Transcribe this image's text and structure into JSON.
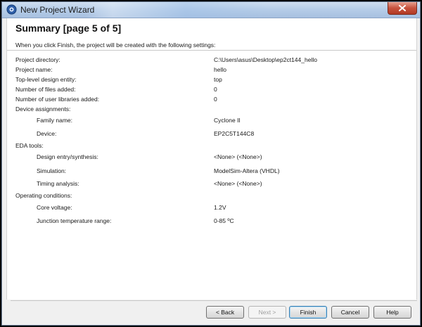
{
  "window": {
    "title": "New Project Wizard"
  },
  "page": {
    "title": "Summary [page 5 of 5]",
    "intro": "When you click Finish, the project will be created with the following settings:"
  },
  "rows": [
    {
      "label": "Project directory:",
      "value": "C:\\Users\\asus\\Desktop\\ep2ct144_hello"
    },
    {
      "label": "Project name:",
      "value": "hello"
    },
    {
      "label": "Top-level design entity:",
      "value": "top"
    },
    {
      "label": "Number of files added:",
      "value": "0"
    },
    {
      "label": "Number of user libraries added:",
      "value": "0"
    },
    {
      "label": "Device assignments:",
      "value": ""
    },
    {
      "label": "Family name:",
      "value": "Cyclone II"
    },
    {
      "label": "Device:",
      "value": "EP2C5T144C8"
    },
    {
      "label": "EDA tools:",
      "value": ""
    },
    {
      "label": "Design entry/synthesis:",
      "value": "<None> (<None>)"
    },
    {
      "label": "Simulation:",
      "value": "ModelSim-Altera (VHDL)"
    },
    {
      "label": "Timing analysis:",
      "value": "<None> (<None>)"
    },
    {
      "label": "Operating conditions:",
      "value": ""
    },
    {
      "label": "Core voltage:",
      "value": "1.2V"
    },
    {
      "label": "Junction temperature range:",
      "value": "0-85 ºC"
    }
  ],
  "buttons": {
    "back": "< Back",
    "next": "Next >",
    "finish": "Finish",
    "cancel": "Cancel",
    "help": "Help"
  },
  "icons": {
    "app": "quartus-wizard-icon",
    "close": "close-icon"
  },
  "colors": {
    "close_button": "#c6523d",
    "titlebar": "#b6cde8"
  }
}
